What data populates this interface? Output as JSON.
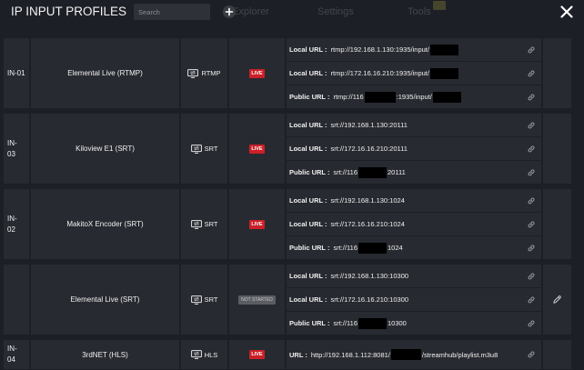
{
  "header": {
    "title": "IP INPUT PROFILES",
    "search_placeholder": "Search"
  },
  "background_tabs": [
    {
      "label": "Explorer"
    },
    {
      "label": "Settings"
    },
    {
      "label": "Tools"
    }
  ],
  "icons": {
    "add": "plus-icon",
    "close": "close-icon",
    "protocol": "screen-cast-icon",
    "url_action": "link-icon",
    "edit": "pencil-icon"
  },
  "colors": {
    "background": "#1d1f26",
    "cell": "#282a31",
    "status_live": "#cc1f27",
    "status_not_started": "#5b5d64",
    "redaction": "#000000"
  },
  "profiles": [
    {
      "id": "IN-01",
      "name": "Elemental Live (RTMP)",
      "protocol": "RTMP",
      "status": "LIVE",
      "urls": [
        {
          "label": "Local URL :",
          "segments": [
            {
              "text": "rtmp://192.168.1.130:1935/input/"
            },
            {
              "redacted": true
            }
          ]
        },
        {
          "label": "Local URL :",
          "segments": [
            {
              "text": "rtmp://172.16.16.210:1935/input/"
            },
            {
              "redacted": true
            }
          ]
        },
        {
          "label": "Public URL :",
          "segments": [
            {
              "text": "rtmp://116"
            },
            {
              "redacted": true
            },
            {
              "text": ":1935/input/"
            },
            {
              "redacted": true
            }
          ]
        }
      ]
    },
    {
      "id": "IN-03",
      "name": "Kiloview E1 (SRT)",
      "protocol": "SRT",
      "status": "LIVE",
      "urls": [
        {
          "label": "Local URL :",
          "segments": [
            {
              "text": "srt://192.168.1.130:20111"
            }
          ]
        },
        {
          "label": "Local URL :",
          "segments": [
            {
              "text": "srt://172.16.16.210:20111"
            }
          ]
        },
        {
          "label": "Public URL :",
          "segments": [
            {
              "text": "srt://116"
            },
            {
              "redacted": true
            },
            {
              "text": "20111"
            }
          ]
        }
      ]
    },
    {
      "id": "IN-02",
      "name": "MakitoX Encoder (SRT)",
      "protocol": "SRT",
      "status": "LIVE",
      "urls": [
        {
          "label": "Local URL :",
          "segments": [
            {
              "text": "srt://192.168.1.130:1024"
            }
          ]
        },
        {
          "label": "Local URL :",
          "segments": [
            {
              "text": "srt://172.16.16.210:1024"
            }
          ]
        },
        {
          "label": "Public URL :",
          "segments": [
            {
              "text": "srt://116"
            },
            {
              "redacted": true
            },
            {
              "text": "1024"
            }
          ]
        }
      ]
    },
    {
      "name": "Elemental Live (SRT)",
      "protocol": "SRT",
      "status": "NOT STARTED",
      "urls": [
        {
          "label": "Local URL :",
          "segments": [
            {
              "text": "srt://192.168.1.130:10300"
            }
          ]
        },
        {
          "label": "Local URL :",
          "segments": [
            {
              "text": "srt://172.16.16.210:10300"
            }
          ]
        },
        {
          "label": "Public URL :",
          "segments": [
            {
              "text": "srt://116"
            },
            {
              "redacted": true
            },
            {
              "text": "10300"
            }
          ]
        }
      ]
    },
    {
      "id": "IN-04",
      "name": "3rdNET (HLS)",
      "protocol": "HLS",
      "status": "LIVE",
      "urls": [
        {
          "label": "URL :",
          "segments": [
            {
              "text": "http://192.168.1.112:8081/"
            },
            {
              "redacted": true
            },
            {
              "text": "/streamhub/playlist.m3u8"
            }
          ]
        }
      ]
    }
  ]
}
